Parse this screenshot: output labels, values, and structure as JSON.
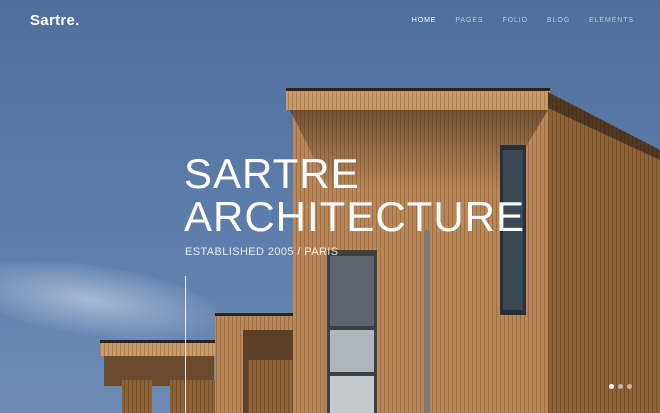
{
  "brand": {
    "logo": "Sartre."
  },
  "nav": {
    "items": [
      {
        "label": "HOME",
        "active": true
      },
      {
        "label": "PAGES",
        "active": false
      },
      {
        "label": "FOLIO",
        "active": false
      },
      {
        "label": "BLOG",
        "active": false
      },
      {
        "label": "ELEMENTS",
        "active": false
      }
    ]
  },
  "hero": {
    "title_line1": "SARTRE",
    "title_line2": "ARCHITECTURE",
    "subtitle": "ESTABLISHED 2005 / PARIS"
  },
  "slider": {
    "count": 3,
    "active_index": 0
  },
  "colors": {
    "sky": "#5a79a6",
    "wood": "#b8875a",
    "text": "#ffffff"
  }
}
